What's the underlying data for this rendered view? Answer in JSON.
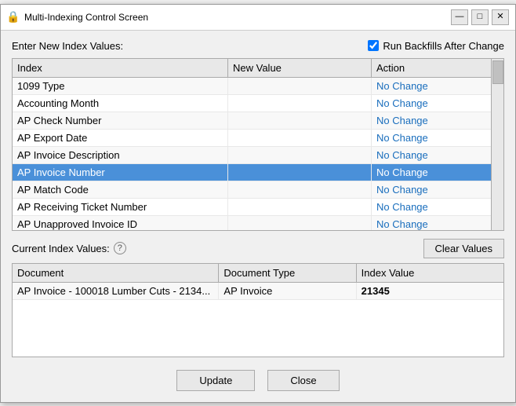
{
  "window": {
    "title": "Multi-Indexing Control Screen",
    "icon": "🔒"
  },
  "titlebar": {
    "minimize": "—",
    "maximize": "□",
    "close": "✕"
  },
  "form": {
    "enter_label": "Enter New Index Values:",
    "run_backfills_label": "Run Backfills After Change",
    "run_backfills_checked": true
  },
  "index_table": {
    "columns": [
      "Index",
      "New Value",
      "Action"
    ],
    "rows": [
      {
        "index": "1099 Type",
        "new_value": "",
        "action": "No Change",
        "selected": false
      },
      {
        "index": "Accounting Month",
        "new_value": "",
        "action": "No Change",
        "selected": false
      },
      {
        "index": "AP Check Number",
        "new_value": "",
        "action": "No Change",
        "selected": false
      },
      {
        "index": "AP Export Date",
        "new_value": "",
        "action": "No Change",
        "selected": false
      },
      {
        "index": "AP Invoice Description",
        "new_value": "",
        "action": "No Change",
        "selected": false
      },
      {
        "index": "AP Invoice Number",
        "new_value": "",
        "action": "No Change",
        "selected": true
      },
      {
        "index": "AP Match Code",
        "new_value": "",
        "action": "No Change",
        "selected": false
      },
      {
        "index": "AP Receiving Ticket Number",
        "new_value": "",
        "action": "No Change",
        "selected": false
      },
      {
        "index": "AP Unapproved Invoice ID",
        "new_value": "",
        "action": "No Change",
        "selected": false
      }
    ]
  },
  "current_index": {
    "label": "Current Index Values:",
    "clear_btn": "Clear Values",
    "columns": [
      "Document",
      "Document Type",
      "Index Value"
    ],
    "rows": [
      {
        "document": "AP Invoice - 100018 Lumber Cuts - 2134...",
        "doc_type": "AP Invoice",
        "index_value": "21345"
      }
    ]
  },
  "buttons": {
    "update": "Update",
    "close": "Close"
  }
}
